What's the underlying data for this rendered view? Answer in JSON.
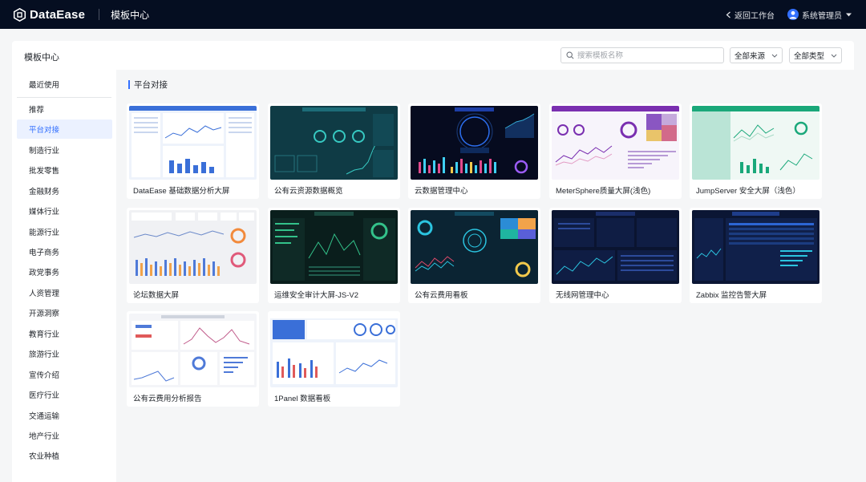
{
  "app": {
    "logo_text": "DataEase",
    "section_title": "模板中心",
    "back_label": "返回工作台",
    "user_name": "系统管理员"
  },
  "page": {
    "title": "模板中心",
    "search_placeholder": "搜索模板名称",
    "source_filter": "全部来源",
    "type_filter": "全部类型"
  },
  "sidebar": {
    "items": [
      {
        "label": "最近使用"
      },
      {
        "label": "推荐"
      },
      {
        "label": "平台对接"
      },
      {
        "label": "制造行业"
      },
      {
        "label": "批发零售"
      },
      {
        "label": "金融财务"
      },
      {
        "label": "媒体行业"
      },
      {
        "label": "能源行业"
      },
      {
        "label": "电子商务"
      },
      {
        "label": "政党事务"
      },
      {
        "label": "人资管理"
      },
      {
        "label": "开源洞察"
      },
      {
        "label": "教育行业"
      },
      {
        "label": "旅游行业"
      },
      {
        "label": "宣传介绍"
      },
      {
        "label": "医疗行业"
      },
      {
        "label": "交通运输"
      },
      {
        "label": "地产行业"
      },
      {
        "label": "农业种植"
      }
    ],
    "active_index": 2
  },
  "content": {
    "section_title": "平台对接",
    "templates": [
      {
        "name": "DataEase  基础数据分析大屏",
        "theme": "light-blue"
      },
      {
        "name": "公有云资源数据概览",
        "theme": "dark-teal"
      },
      {
        "name": "云数据管理中心",
        "theme": "dark-navy"
      },
      {
        "name": "MeterSphere质量大屏(浅色)",
        "theme": "light-purple"
      },
      {
        "name": "JumpServer  安全大屏（浅色）",
        "theme": "light-green"
      },
      {
        "name": "论坛数据大屏",
        "theme": "light-gray"
      },
      {
        "name": "运维安全审计大屏-JS-V2",
        "theme": "dark-green"
      },
      {
        "name": "公有云费用看板",
        "theme": "dark-teal-2"
      },
      {
        "name": "无线网管理中心",
        "theme": "dark-blue"
      },
      {
        "name": "Zabbix  监控告警大屏",
        "theme": "dark-blue-2"
      },
      {
        "name": "公有云费用分析报告",
        "theme": "light-report"
      },
      {
        "name": "1Panel  数据看板",
        "theme": "light-panel"
      }
    ]
  },
  "colors": {
    "topbar": "#050e21",
    "accent": "#3370ff",
    "active_bg": "#ebf1ff"
  }
}
